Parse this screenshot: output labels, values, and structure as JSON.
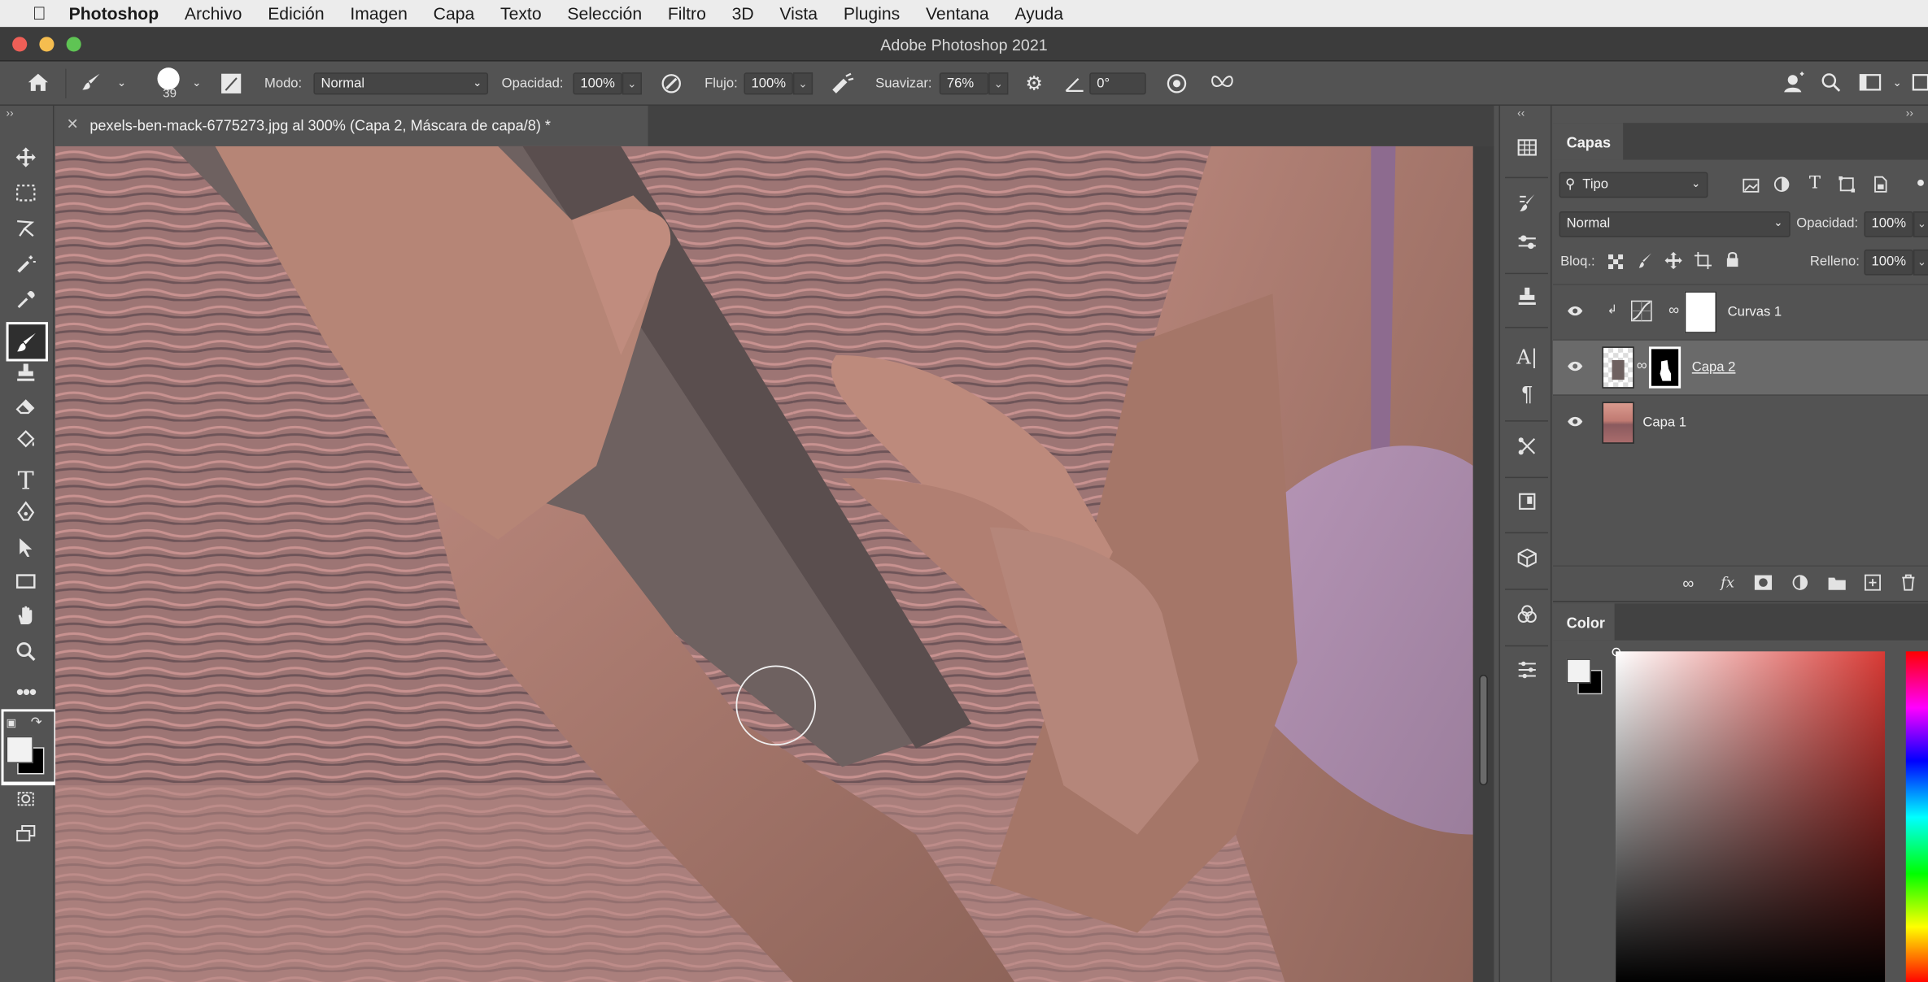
{
  "menubar": {
    "app_name": "Photoshop",
    "items": [
      "Archivo",
      "Edición",
      "Imagen",
      "Capa",
      "Texto",
      "Selección",
      "Filtro",
      "3D",
      "Vista",
      "Plugins",
      "Ventana",
      "Ayuda"
    ]
  },
  "window": {
    "title": "Adobe Photoshop 2021"
  },
  "options": {
    "brush_size": "39",
    "mode_label": "Modo:",
    "mode_value": "Normal",
    "opacity_label": "Opacidad:",
    "opacity_value": "100%",
    "flow_label": "Flujo:",
    "flow_value": "100%",
    "smoothing_label": "Suavizar:",
    "smoothing_value": "76%",
    "angle_value": "0°"
  },
  "document": {
    "tab_title": "pexels-ben-mack-6775273.jpg al 300% (Capa 2, Máscara de capa/8) *"
  },
  "layers_panel": {
    "tab_label": "Capas",
    "filter_value": "Tipo",
    "blend_mode": "Normal",
    "opacity_label": "Opacidad:",
    "opacity_value": "100%",
    "lock_label": "Bloq.:",
    "fill_label": "Relleno:",
    "fill_value": "100%",
    "layers": [
      {
        "name": "Curvas 1",
        "selected": false
      },
      {
        "name": "Capa 2",
        "selected": true
      },
      {
        "name": "Capa 1",
        "selected": false
      }
    ]
  },
  "color_panel": {
    "tab_label": "Color",
    "picker_hue": "#d83a35"
  },
  "colors": {
    "foreground": "#f2f2f2",
    "background": "#000000",
    "ui_dark": "#535353",
    "menubar": "#ececec"
  }
}
